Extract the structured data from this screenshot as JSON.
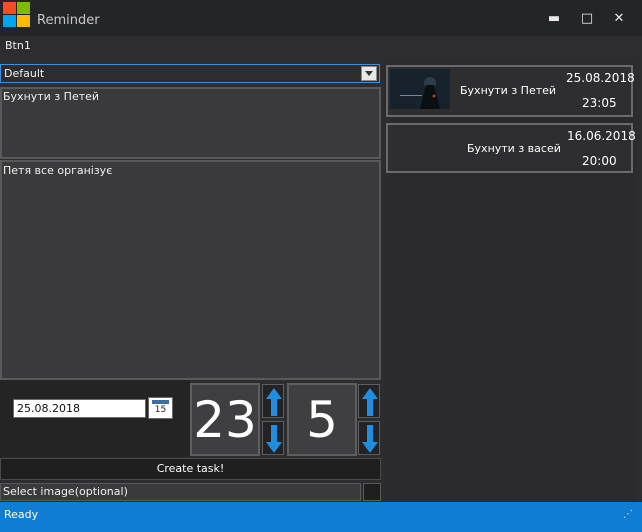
{
  "window": {
    "title": "Reminder",
    "min_glyph": "▬",
    "max_glyph": "□",
    "close_glyph": "✕"
  },
  "menu": {
    "btn1_label": "Btn1"
  },
  "form": {
    "category_selected": "Default",
    "task_title": "Бухнути з Петей",
    "task_description": "Петя все організує",
    "date_value": "25.08.2018",
    "calendar_day": "15",
    "hours": "23",
    "minutes": "5",
    "create_button_label": "Create task!",
    "image_select_label": "Select image(optional)"
  },
  "tasks": [
    {
      "title": "Бухнути з Петей",
      "date": "25.08.2018",
      "time": "23:05",
      "has_image": true
    },
    {
      "title": "Бухнути з васей",
      "date": "16.06.2018",
      "time": "20:00",
      "has_image": false
    }
  ],
  "status": {
    "text": "Ready",
    "grip": "⋰"
  },
  "colors": {
    "accent": "#0f7dd3",
    "spin_arrow": "#1f8de0",
    "window_bg": "#2d2d30"
  }
}
